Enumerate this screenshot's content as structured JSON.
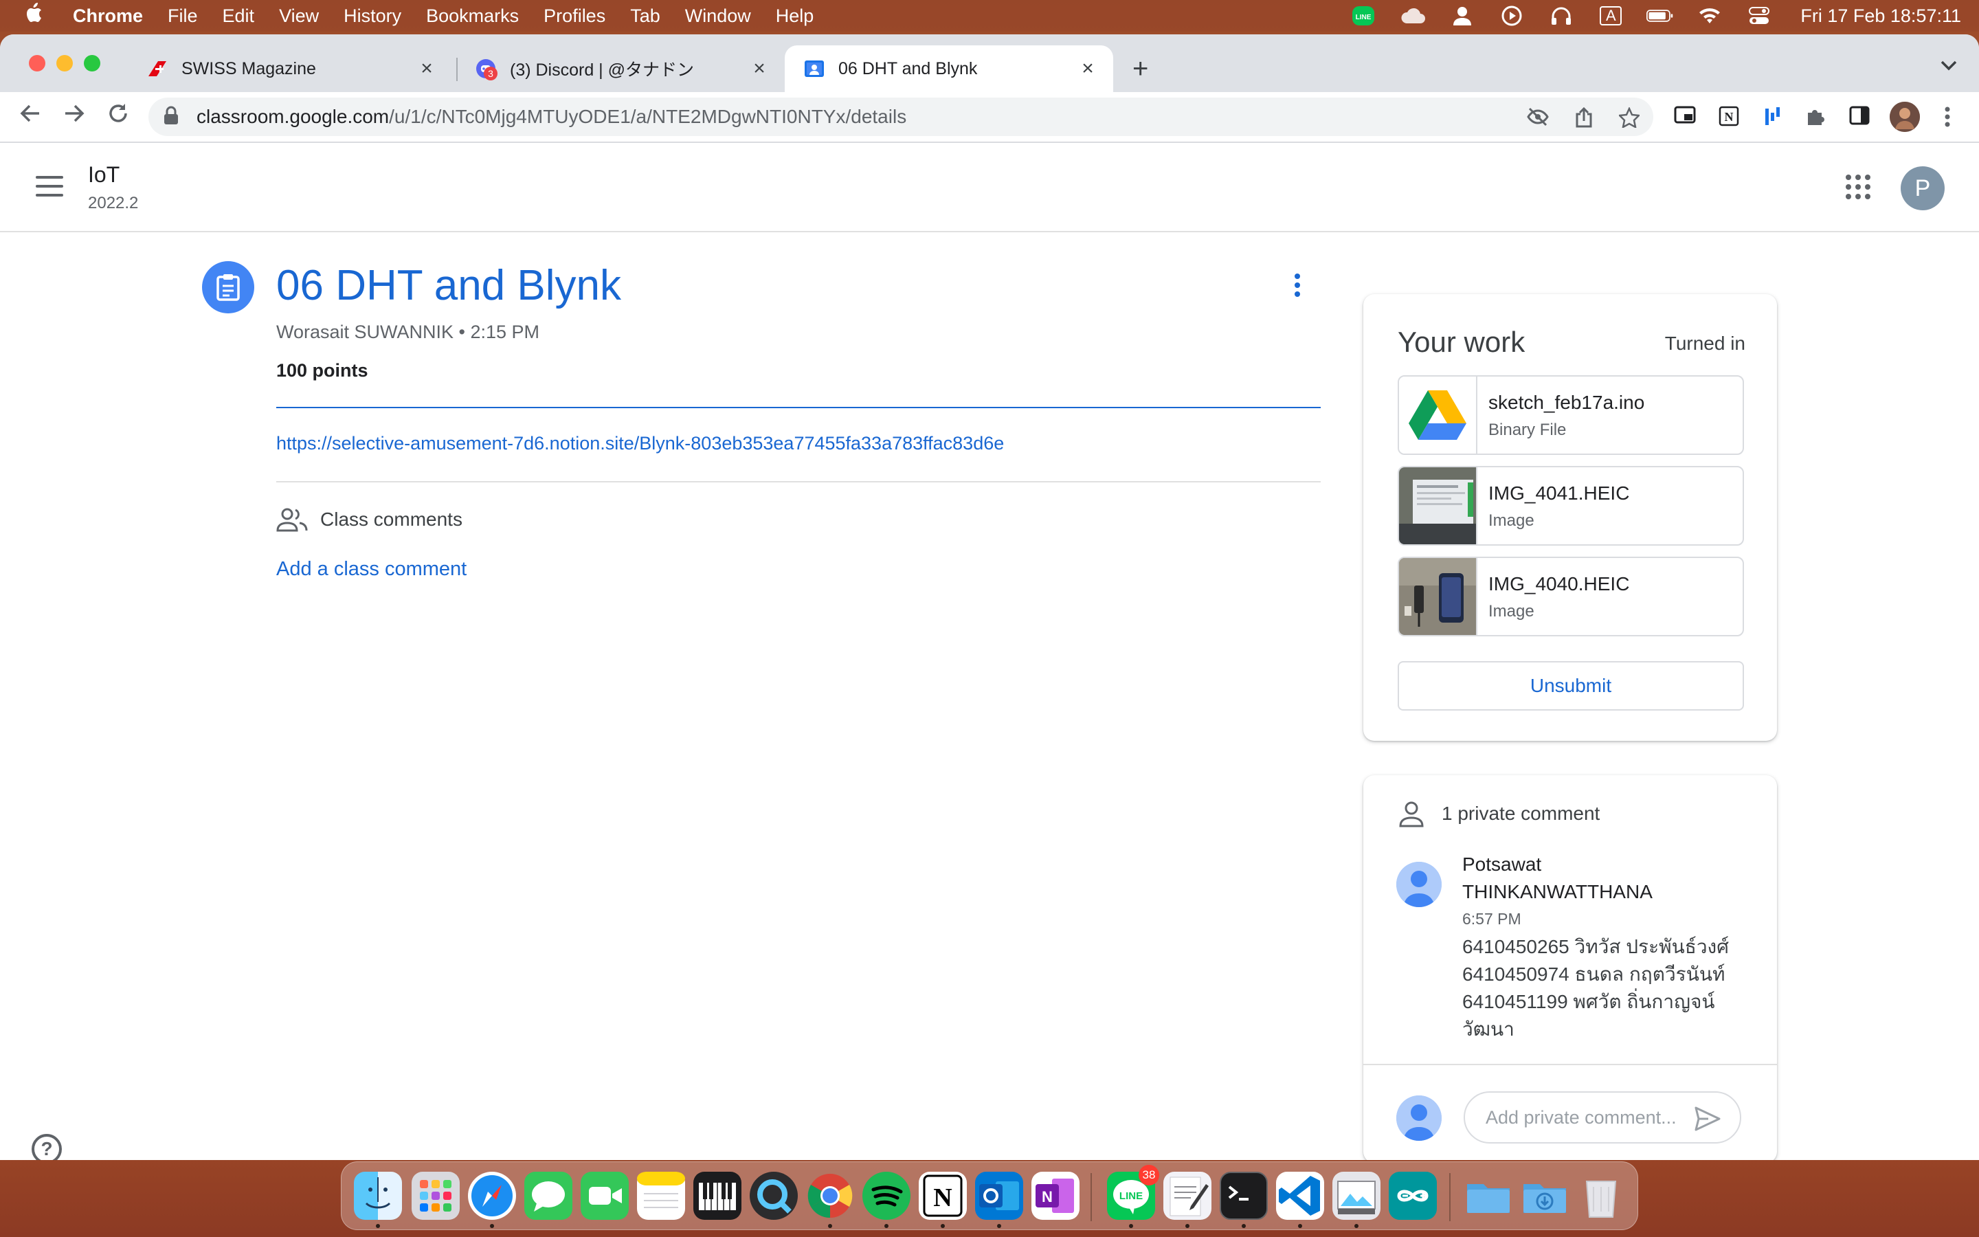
{
  "menubar": {
    "app_name": "Chrome",
    "menus": [
      "File",
      "Edit",
      "View",
      "History",
      "Bookmarks",
      "Profiles",
      "Tab",
      "Window",
      "Help"
    ],
    "input_indicator": "A",
    "datetime": "Fri 17 Feb  18:57:11"
  },
  "browser": {
    "tabs": [
      {
        "title": "SWISS Magazine",
        "favicon_color": "#e30613"
      },
      {
        "title": "(3) Discord | @タナドン",
        "favicon_color": "#5865f2",
        "badge": "3"
      },
      {
        "title": "06 DHT and Blynk",
        "favicon_color": "#1e8e3e",
        "active": true
      }
    ],
    "new_tab_label": "+",
    "url_host": "classroom.google.com",
    "url_path": "/u/1/c/NTc0Mjg4MTUyODE1/a/NTE2MDgwNTI0NTYx/details"
  },
  "classroom": {
    "class_name": "IoT",
    "class_section": "2022.2",
    "account_initial": "P",
    "assignment": {
      "title": "06 DHT and Blynk",
      "author": "Worasait SUWANNIK",
      "posted_time": "2:15 PM",
      "meta": "Worasait SUWANNIK • 2:15 PM",
      "points": "100 points",
      "link": "https://selective-amusement-7d6.notion.site/Blynk-803eb353ea77455fa33a783ffac83d6e"
    },
    "class_comments": {
      "label": "Class comments",
      "add_label": "Add a class comment"
    },
    "your_work": {
      "title": "Your work",
      "status": "Turned in",
      "attachments": [
        {
          "name": "sketch_feb17a.ino",
          "type": "Binary File",
          "thumb": "google-drive-icon"
        },
        {
          "name": "IMG_4041.HEIC",
          "type": "Image",
          "thumb": "photo-thumbnail"
        },
        {
          "name": "IMG_4040.HEIC",
          "type": "Image",
          "thumb": "photo-thumbnail"
        }
      ],
      "unsubmit_label": "Unsubmit"
    },
    "private_comments": {
      "title": "1 private comment",
      "author_line1": "Potsawat",
      "author_line2": "THINKANWATTHANA",
      "time": "6:57 PM",
      "body_lines": [
        "6410450265  วิทวัส ประพันธ์วงศ์",
        "6410450974  ธนดล กฤตวีรนันท์",
        "6410451199  พศวัต ถิ่นกาญจน์",
        "วัฒนา"
      ],
      "input_placeholder": "Add private comment..."
    }
  },
  "dock": {
    "line_badge": "38",
    "apps": [
      "finder-icon",
      "launchpad-icon",
      "safari-icon",
      "messages-icon",
      "facetime-icon",
      "notes-icon",
      "piano-icon",
      "quicktime-icon",
      "chrome-icon",
      "spotify-icon",
      "notion-icon",
      "outlook-icon",
      "onenote-icon",
      "line-icon",
      "textedit-icon",
      "terminal-icon",
      "vscode-icon",
      "preview-icon",
      "arduino-icon",
      "folder-icon",
      "downloads-icon",
      "trash-icon"
    ]
  },
  "colors": {
    "accent": "#1967d2",
    "assignment_icon_bg": "#4285f4"
  }
}
